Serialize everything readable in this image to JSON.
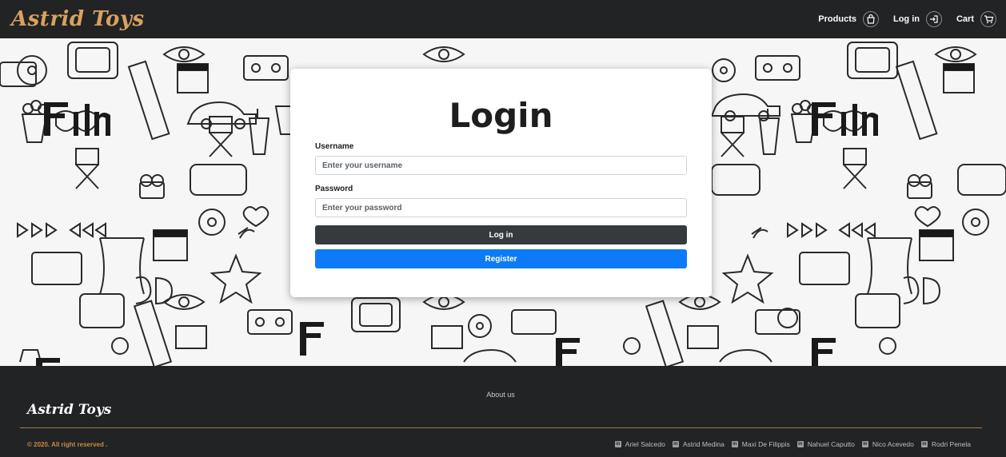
{
  "header": {
    "brand": "Astrid Toys",
    "nav": [
      {
        "label": "Products",
        "icon": "shopping-bag-icon"
      },
      {
        "label": "Log in",
        "icon": "login-icon"
      },
      {
        "label": "Cart",
        "icon": "cart-icon"
      }
    ]
  },
  "login": {
    "title": "Login",
    "username_label": "Username",
    "username_placeholder": "Enter your username",
    "password_label": "Password",
    "password_placeholder": "Enter your password",
    "login_button": "Log in",
    "register_button": "Register"
  },
  "footer": {
    "about": "About us",
    "brand": "Astrid Toys",
    "copyright": "© 2020. All right reserved .",
    "people": [
      "Ariel Salcedo",
      "Astrid Medina",
      "Maxi De Filippis",
      "Nahuel Caputto",
      "Nico Acevedo",
      "Rodri Penela"
    ],
    "people_icon": "linkedin-icon"
  },
  "colors": {
    "header_bg": "#222324",
    "brand": "#d9a15f",
    "login_button": "#343a40",
    "register_button": "#0d7bf7",
    "footer_accent": "#c9894a"
  }
}
